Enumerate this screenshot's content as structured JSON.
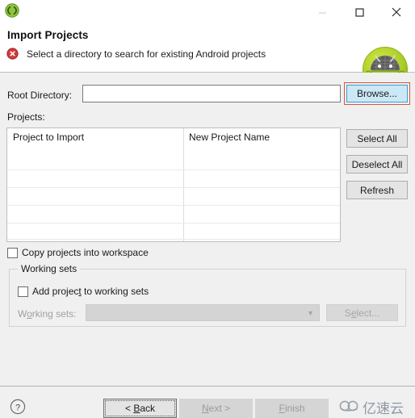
{
  "window": {
    "app_icon": "eclipse-icon",
    "controls": {
      "minimize": "minimize-icon",
      "maximize": "maximize-icon",
      "close": "close-icon"
    }
  },
  "header": {
    "title": "Import Projects",
    "description": "Select a directory to search for existing Android projects",
    "status_icon": "error-icon",
    "brand_icon": "android-robot-icon",
    "error_color": "#d13b3b"
  },
  "form": {
    "root_directory_label": "Root Directory:",
    "root_directory_value": "",
    "root_directory_placeholder": "",
    "browse_label": "Browse...",
    "projects_label": "Projects:"
  },
  "table": {
    "columns": [
      "Project to Import",
      "New Project Name"
    ],
    "rows": []
  },
  "side_buttons": [
    {
      "label": "Select All"
    },
    {
      "label": "Deselect All"
    },
    {
      "label": "Refresh"
    }
  ],
  "options": {
    "copy_projects": {
      "label": "Copy projects into workspace",
      "checked": false
    }
  },
  "working_sets": {
    "group_label": "Working sets",
    "add_project": {
      "label_before": "Add projec",
      "label_mnemonic": "t",
      "label_after": " to working sets",
      "checked": false
    },
    "combo_label_before": "W",
    "combo_label_mnemonic": "o",
    "combo_label_after": "rking sets:",
    "combo_value": "",
    "combo_chevron": "chevron-down-icon",
    "select_label_before": "S",
    "select_label_mnemonic": "e",
    "select_label_after": "lect...",
    "disabled": true
  },
  "footer": {
    "help_icon": "help-icon",
    "back": {
      "prefix": "< ",
      "mnemonic": "B",
      "suffix": "ack"
    },
    "next": {
      "prefix": "",
      "mnemonic": "N",
      "suffix": "ext >"
    },
    "finish": {
      "prefix": "",
      "mnemonic": "F",
      "suffix": "inish"
    },
    "watermark_text": "亿速云",
    "watermark_icon": "cloud-logo-icon"
  }
}
